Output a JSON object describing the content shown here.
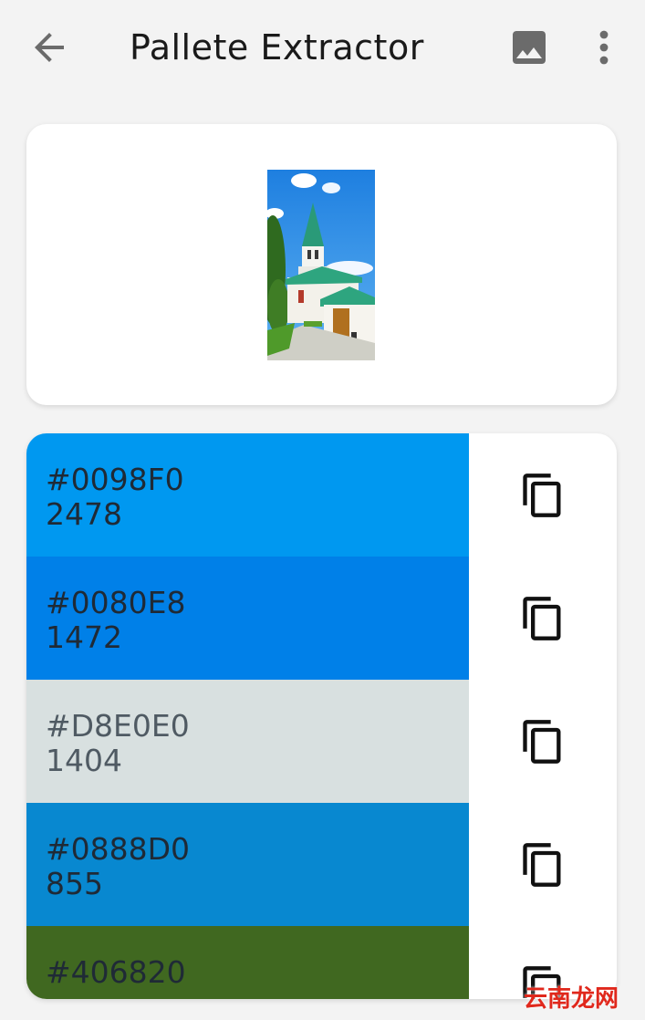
{
  "app_bar": {
    "title": "Pallete Extractor",
    "back_icon": "arrow-back-icon",
    "image_icon": "image-icon",
    "more_icon": "more-vert-icon"
  },
  "preview": {
    "description_icon": "church-photo"
  },
  "palette": [
    {
      "hex": "#0098F0",
      "count": "2478",
      "color": "#0098f0",
      "copy_icon": "copy-icon"
    },
    {
      "hex": "#0080E8",
      "count": "1472",
      "color": "#0080e8",
      "copy_icon": "copy-icon"
    },
    {
      "hex": "#D8E0E0",
      "count": "1404",
      "color": "#d8e0e0",
      "copy_icon": "copy-icon"
    },
    {
      "hex": "#0888D0",
      "count": "855",
      "color": "#0888d0",
      "copy_icon": "copy-icon"
    },
    {
      "hex": "#406820",
      "count": "",
      "color": "#406820",
      "copy_icon": "copy-icon"
    }
  ],
  "watermark": "云南龙网"
}
